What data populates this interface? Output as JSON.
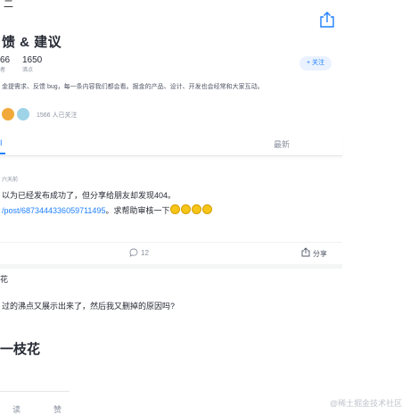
{
  "header": {
    "top_cut": "二",
    "share_icon": "share-icon"
  },
  "circle": {
    "title": "馈 & 建议",
    "stats": [
      {
        "value": "66",
        "label": "者"
      },
      {
        "value": "1650",
        "label": "沸点"
      }
    ],
    "follow_label": "+ 关注",
    "description": "金提需求、反馈 bug，每一条内容我们都会看。掘金的产品、设计、开发也会经常和大家互动。",
    "followers_text": "1566 人已关注"
  },
  "tabs": {
    "hot": "I",
    "latest": "最新"
  },
  "post1": {
    "time": "六天前",
    "line1": "以为已经发布成功了，但分享给朋友却发现404。",
    "link": "/post/6873444336059711495",
    "line2_suffix": "。求帮助审核一下",
    "comment_count": "12",
    "share_label": "分享"
  },
  "post2": {
    "author": "花",
    "text": "过的沸点又展示出来了，然后我又删掉的原因吗?"
  },
  "bottom": {
    "name": "一枝花",
    "cut_left": "读",
    "cut_right": "赞"
  },
  "watermark": "@稀土掘金技术社区",
  "colors": {
    "accent": "#1e80ff",
    "muted": "#8a919f",
    "text": "#252933"
  }
}
